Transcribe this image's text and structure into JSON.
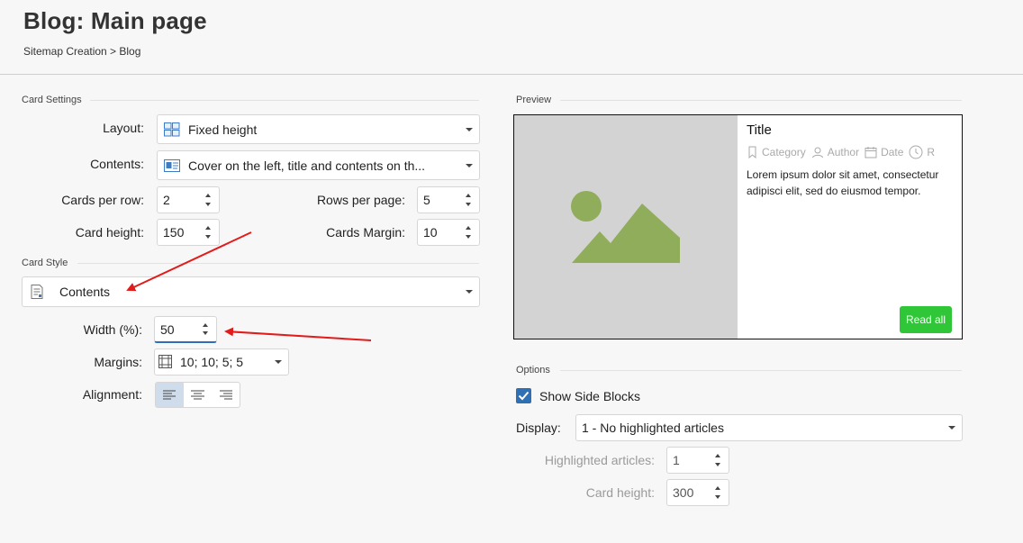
{
  "header": {
    "title": "Blog: Main page",
    "breadcrumb": "Sitemap Creation > Blog"
  },
  "card_settings": {
    "section_label": "Card Settings",
    "layout": {
      "label": "Layout:",
      "value": "Fixed height",
      "icon": "grid-layout-icon"
    },
    "contents": {
      "label": "Contents:",
      "value": "Cover on the left, title and contents on th...",
      "icon": "image-text-card-icon"
    },
    "cards_per_row": {
      "label": "Cards per row:",
      "value": "2"
    },
    "rows_per_page": {
      "label": "Rows per page:",
      "value": "5"
    },
    "card_height": {
      "label": "Card height:",
      "value": "150"
    },
    "cards_margin": {
      "label": "Cards Margin:",
      "value": "10"
    }
  },
  "card_style": {
    "section_label": "Card Style",
    "selector": {
      "value": "Contents",
      "icon": "document-icon"
    },
    "width": {
      "label": "Width (%):",
      "value": "50"
    },
    "margins": {
      "label": "Margins:",
      "value": "10; 10; 5; 5",
      "icon": "margins-grid-icon"
    },
    "alignment": {
      "label": "Alignment:",
      "options": [
        "align-left-icon",
        "align-center-icon",
        "align-right-icon"
      ],
      "selected": "align-left-icon"
    }
  },
  "preview": {
    "section_label": "Preview",
    "title": "Title",
    "meta": [
      {
        "icon": "bookmark-icon",
        "text": "Category"
      },
      {
        "icon": "user-icon",
        "text": "Author"
      },
      {
        "icon": "calendar-icon",
        "text": "Date"
      },
      {
        "icon": "clock-icon",
        "text": "R"
      }
    ],
    "body": "Lorem ipsum dolor sit amet, consectetur adipisci elit, sed do eiusmod tempor.",
    "button": "Read all",
    "colors": {
      "placeholder_bg": "#d3d3d3",
      "placeholder_art": "#8fad5a",
      "button_bg": "#2fc637"
    }
  },
  "options": {
    "section_label": "Options",
    "show_side_blocks": {
      "label": "Show Side Blocks",
      "checked": true
    },
    "display": {
      "label": "Display:",
      "value": "1 - No highlighted articles"
    },
    "highlighted_articles": {
      "label": "Highlighted articles:",
      "value": "1",
      "disabled": true
    },
    "card_height": {
      "label": "Card height:",
      "value": "300",
      "disabled": true
    }
  },
  "colors": {
    "accent": "#2f6fb3",
    "annotation_arrow": "#e21b1b"
  }
}
